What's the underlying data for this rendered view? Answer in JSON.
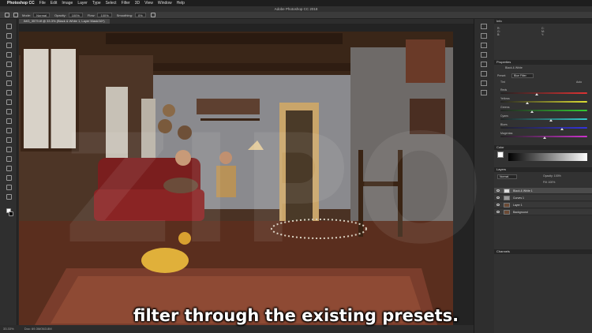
{
  "menubar": {
    "app_name": "Photoshop CC",
    "items": [
      "File",
      "Edit",
      "Image",
      "Layer",
      "Type",
      "Select",
      "Filter",
      "3D",
      "View",
      "Window",
      "Help"
    ]
  },
  "window": {
    "title": "Adobe Photoshop CC 2018"
  },
  "options": {
    "mode_label": "Mode:",
    "mode_value": "Normal",
    "opacity_label": "Opacity:",
    "opacity_value": "100%",
    "flow_label": "Flow:",
    "flow_value": "100%",
    "smoothing_label": "Smoothing:",
    "smoothing_value": "0%"
  },
  "document_tab": {
    "label": "IMG_3579.tif @ 33.3% (Black & White 1, Layer Mask/16*)"
  },
  "status": {
    "zoom": "33.33%",
    "doc_size": "Doc: 69.3M/363.8M"
  },
  "panels": {
    "info_title": "Info",
    "properties_title": "Properties",
    "properties_adjustment": "Black & White",
    "preset_label": "Preset:",
    "preset_value": "Blue Filter",
    "tint_label": "Tint",
    "auto_label": "Auto",
    "color_sliders": [
      "Reds",
      "Yellows",
      "Greens",
      "Cyans",
      "Blues",
      "Magentas"
    ],
    "color_title": "Color",
    "layers_title": "Layers",
    "blend_mode": "Normal",
    "opacity": "Opacity: 100%",
    "fill": "Fill: 100%",
    "layers": [
      "Black & White 1",
      "Curves 1",
      "Layer 1",
      "Background"
    ],
    "channels_title": "Channels"
  },
  "subtitle": "filter through the existing presets.",
  "watermark": "ZIPO",
  "colors": {
    "menubar_bg": "#1e1e1e",
    "panel_bg": "#323232",
    "canvas_bg": "#232323"
  }
}
